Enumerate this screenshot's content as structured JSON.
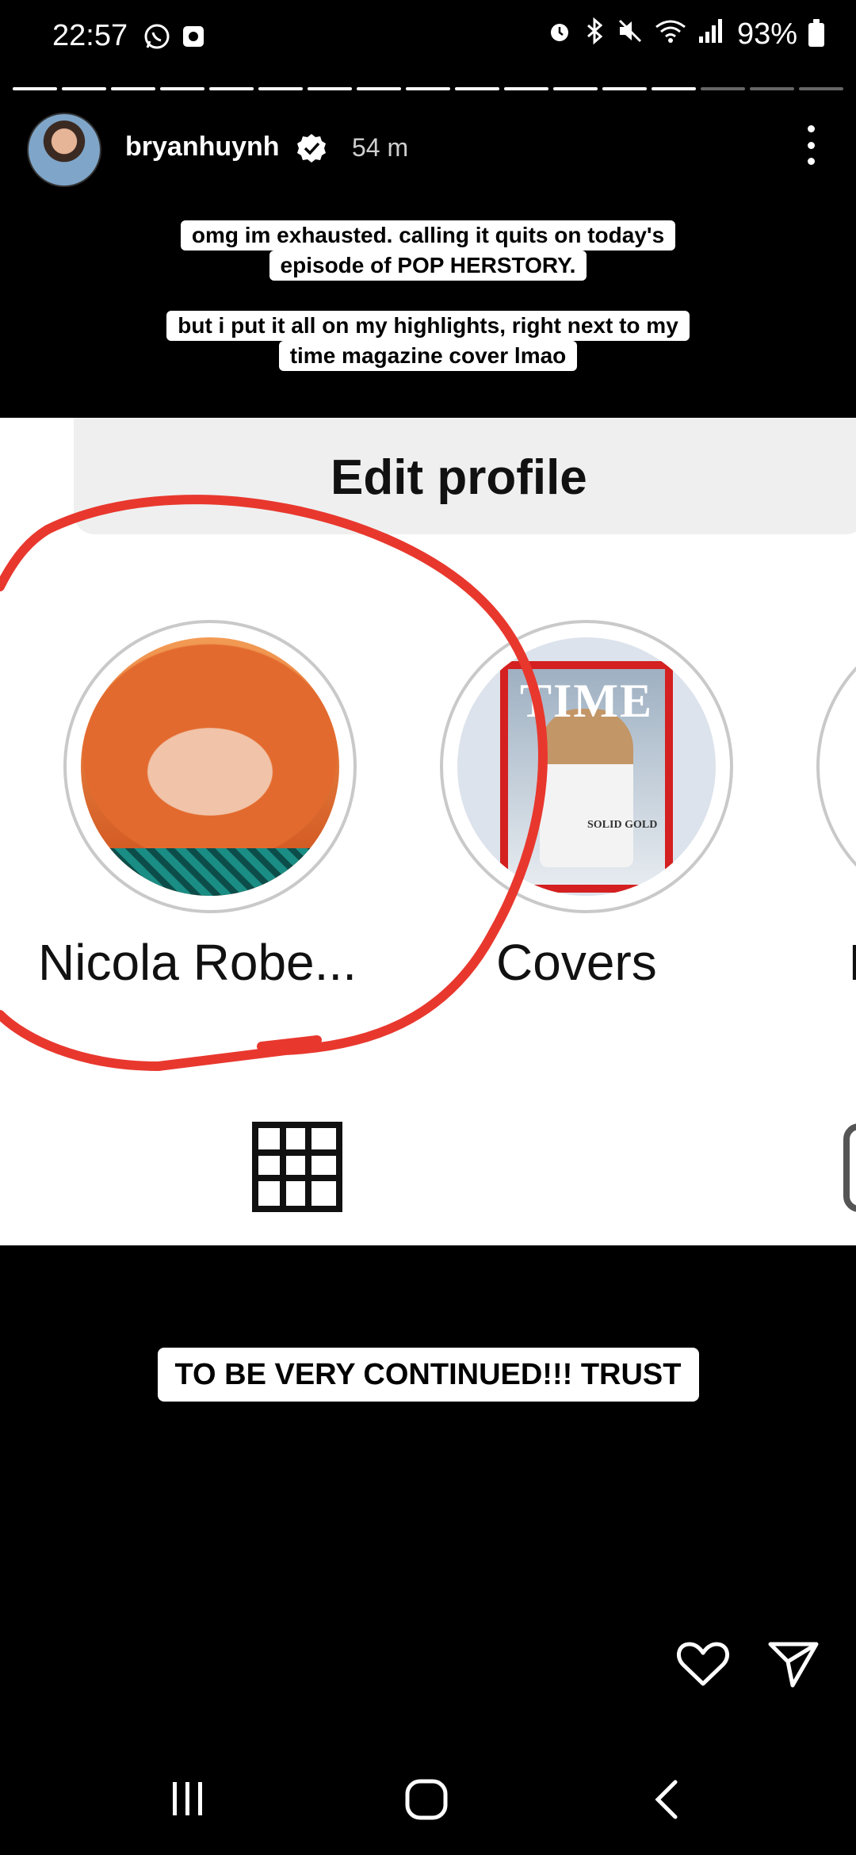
{
  "status_bar": {
    "time": "22:57",
    "battery": "93%",
    "icons": [
      "whatsapp-icon",
      "screen-record-icon",
      "alarm-icon",
      "bluetooth-icon",
      "mute-icon",
      "wifi-icon",
      "signal-icon",
      "battery-icon"
    ]
  },
  "story": {
    "segments_total": 17,
    "segments_viewed": 14,
    "username": "bryanhuynh",
    "verified": true,
    "time_ago": "54 m",
    "caption_1": [
      "omg im exhausted. calling it quits on today's",
      "episode of POP HERSTORY."
    ],
    "caption_2": [
      "but i put it all on my highlights, right next to my",
      "time magazine cover lmao"
    ],
    "caption_3": "TO BE VERY CONTINUED!!! TRUST"
  },
  "screenshot": {
    "edit_profile_label": "Edit profile",
    "highlights": [
      {
        "label": "Nicola Robe..."
      },
      {
        "label": "Covers",
        "cover_text": "TIME",
        "cover_sub": "SOLID GOLD"
      },
      {
        "label": "I"
      }
    ],
    "annotation_color": "#e8382e"
  },
  "colors": {
    "background": "#000000",
    "caption_bg": "#ffffff",
    "annotation": "#e8382e"
  }
}
